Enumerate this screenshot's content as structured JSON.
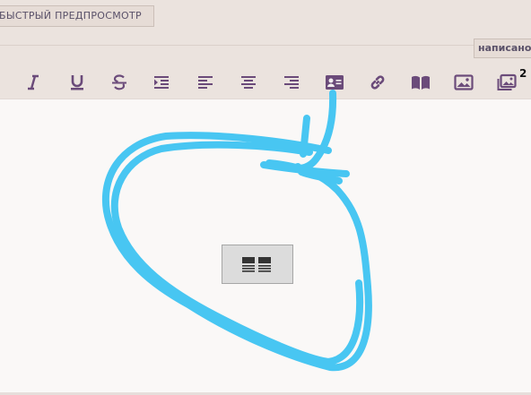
{
  "header": {
    "preview_button_label": "БЫСТРЫЙ ПРЕДПРОСМОТР",
    "written_badge_label": "написано"
  },
  "toolbar": {
    "icon_color": "#6b4b7a",
    "buttons": [
      {
        "name": "italic-button",
        "icon": "italic-icon"
      },
      {
        "name": "underline-button",
        "icon": "underline-icon"
      },
      {
        "name": "strikethrough-button",
        "icon": "strikethrough-icon"
      },
      {
        "name": "indent-button",
        "icon": "indent-icon"
      },
      {
        "name": "align-left-button",
        "icon": "align-left-icon"
      },
      {
        "name": "align-center-button",
        "icon": "align-center-icon"
      },
      {
        "name": "align-right-button",
        "icon": "align-right-icon"
      },
      {
        "name": "insert-block-button",
        "icon": "id-card-icon"
      },
      {
        "name": "insert-link-button",
        "icon": "link-icon"
      },
      {
        "name": "insert-book-button",
        "icon": "book-icon"
      },
      {
        "name": "insert-image-button",
        "icon": "image-icon"
      },
      {
        "name": "insert-gallery-button",
        "icon": "images-icon"
      }
    ],
    "gallery_count": "2"
  },
  "editor": {
    "embedded_block_icon": "two-column-block-icon"
  },
  "annotation": {
    "color": "#48c6f2"
  }
}
